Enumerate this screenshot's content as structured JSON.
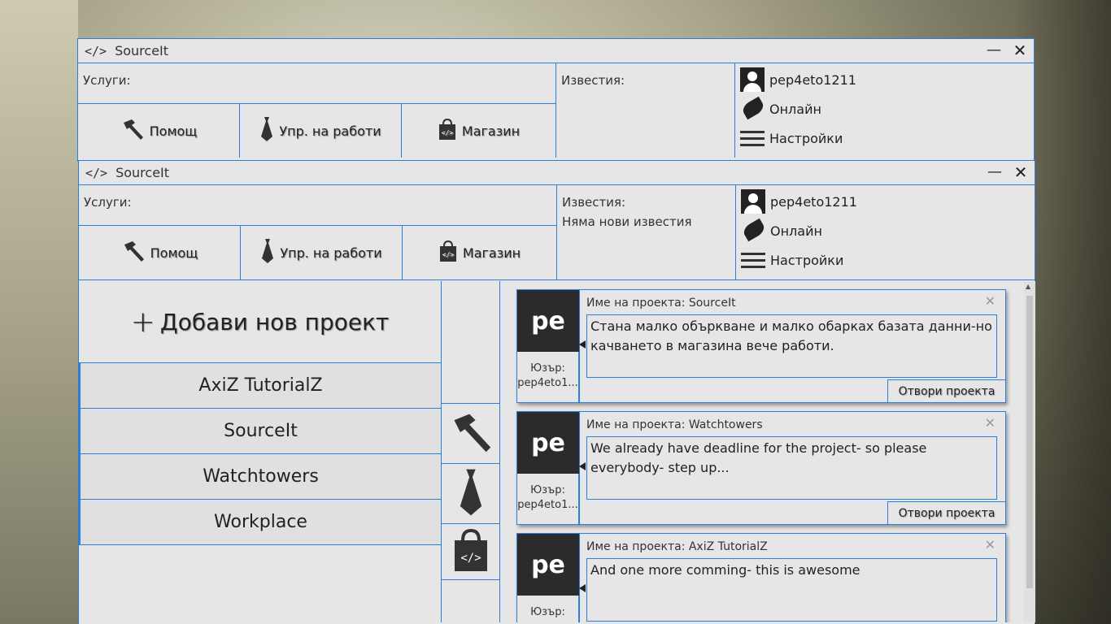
{
  "app": {
    "title": "SourceIt",
    "code_glyph": "</>",
    "minimize": "—",
    "close": "✕"
  },
  "top": {
    "services_label": "Услуги:",
    "notifications_label": "Известия:",
    "notifications_empty": "Няма нови известия",
    "buttons": {
      "help": "Помощ",
      "jobs": "Упр. на работи",
      "store": "Магазин"
    },
    "user": {
      "name": "pep4eto1211",
      "status": "Онлайн",
      "settings": "Настройки"
    }
  },
  "projects": {
    "add_label": "Добави нов проект",
    "plus": "+",
    "items": [
      {
        "name": "AxiZ TutorialZ"
      },
      {
        "name": "SourceIt"
      },
      {
        "name": "Watchtowers"
      },
      {
        "name": "Workplace"
      }
    ]
  },
  "feed": {
    "cards": [
      {
        "avatar": "pe",
        "user_label": "Юзър:",
        "user": "pep4eto1...",
        "project": "Име на проекта: SourceIt",
        "message": "Стана малко объркване и малко обарках базата данни-но качването в магазина вече работи.",
        "open": "Отвори проекта",
        "close": "✕"
      },
      {
        "avatar": "pe",
        "user_label": "Юзър:",
        "user": "pep4eto1...",
        "project": "Име на проекта: Watchtowers",
        "message": "We already have deadline for the project- so please everybody- step up...",
        "open": "Отвори проекта",
        "close": "✕"
      },
      {
        "avatar": "pe",
        "user_label": "Юзър:",
        "user": "",
        "project": "Име на проекта: AxiZ TutorialZ",
        "message": "And one more comming- this is awesome",
        "open": "",
        "close": "✕"
      }
    ]
  },
  "colors": {
    "accent": "#2b7fd9",
    "window_bg": "#e6e6e6",
    "avatar_bg": "#2b2b2b"
  }
}
